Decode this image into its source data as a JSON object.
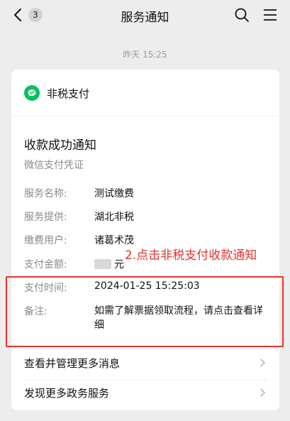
{
  "header": {
    "back_badge": "3",
    "title": "服务通知"
  },
  "timestamp": "昨天 15:25",
  "card": {
    "brand_name": "非税支付",
    "notice_title": "收款成功通知",
    "notice_subtitle": "微信支付凭证",
    "fields": [
      {
        "label": "服务名称:",
        "value": "测试缴费"
      },
      {
        "label": "服务提供:",
        "value": "湖北非税"
      },
      {
        "label": "缴费用户:",
        "value": "诸葛术茂"
      },
      {
        "label": "支付金额:",
        "value": "元"
      },
      {
        "label": "支付时间:",
        "value": "2024-01-25 15:25:03"
      },
      {
        "label": "备注:",
        "value": "如需了解票据领取流程，请点击查看详细"
      }
    ],
    "links": [
      {
        "label": "查看并管理更多消息"
      },
      {
        "label": "发现更多政务服务"
      }
    ]
  },
  "annotation": "2.点击非税支付收款通知",
  "colors": {
    "background": "#ededed",
    "card": "#ffffff",
    "brand_green": "#07c160",
    "annotation_red": "#e8322c"
  },
  "icons": [
    "chevron-left-icon",
    "search-icon",
    "menu-icon",
    "wechat-pay-logo-icon",
    "chevron-right-icon"
  ]
}
